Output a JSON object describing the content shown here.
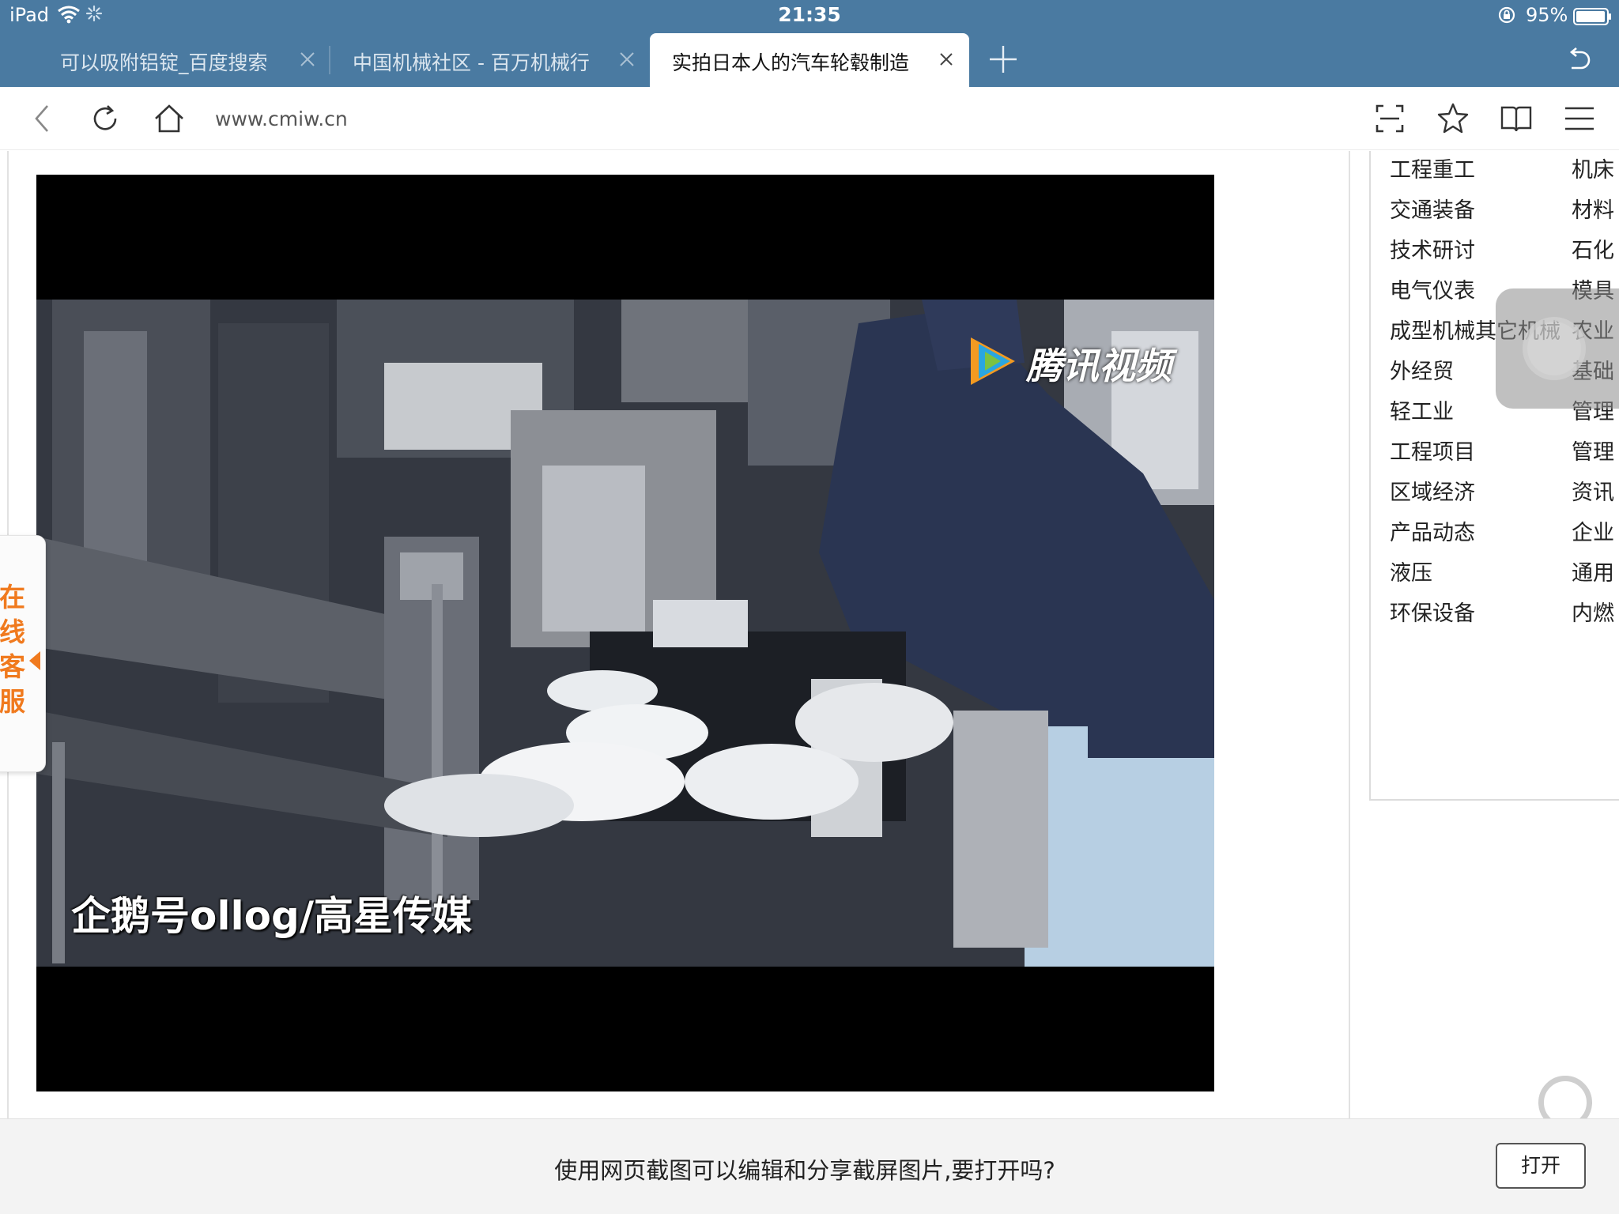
{
  "status_bar": {
    "device": "iPad",
    "time": "21:35",
    "battery_percent": "95%"
  },
  "tabs": [
    {
      "label": "可以吸附铝锭_百度搜索",
      "active": false
    },
    {
      "label": "中国机械社区 - 百万机械行",
      "active": false
    },
    {
      "label": "实拍日本人的汽车轮毂制造",
      "active": true
    }
  ],
  "address_bar": {
    "url": "www.cmiw.cn"
  },
  "video": {
    "watermark_label": "腾讯视频",
    "caption": "企鹅号ollog/高星传媒"
  },
  "categories": [
    [
      "工程重工",
      "机床"
    ],
    [
      "交通装备",
      "材料"
    ],
    [
      "技术研讨",
      "石化"
    ],
    [
      "电气仪表",
      "模具"
    ],
    [
      "成型机械其它机械",
      "农业"
    ],
    [
      "外经贸",
      "基础"
    ],
    [
      "轻工业",
      "管理"
    ],
    [
      "工程项目",
      "管理"
    ],
    [
      "区域经济",
      "资讯"
    ],
    [
      "产品动态",
      "企业"
    ],
    [
      "液压",
      "通用"
    ],
    [
      "环保设备",
      "内燃"
    ]
  ],
  "online_service": {
    "label": "在线客服"
  },
  "prompt_bar": {
    "message": "使用网页截图可以编辑和分享截屏图片,要打开吗?",
    "open_label": "打开"
  },
  "colors": {
    "chrome_blue": "#4a7aa1",
    "service_orange": "#f07a1e",
    "watermark_blue": "#2aa6e0"
  }
}
